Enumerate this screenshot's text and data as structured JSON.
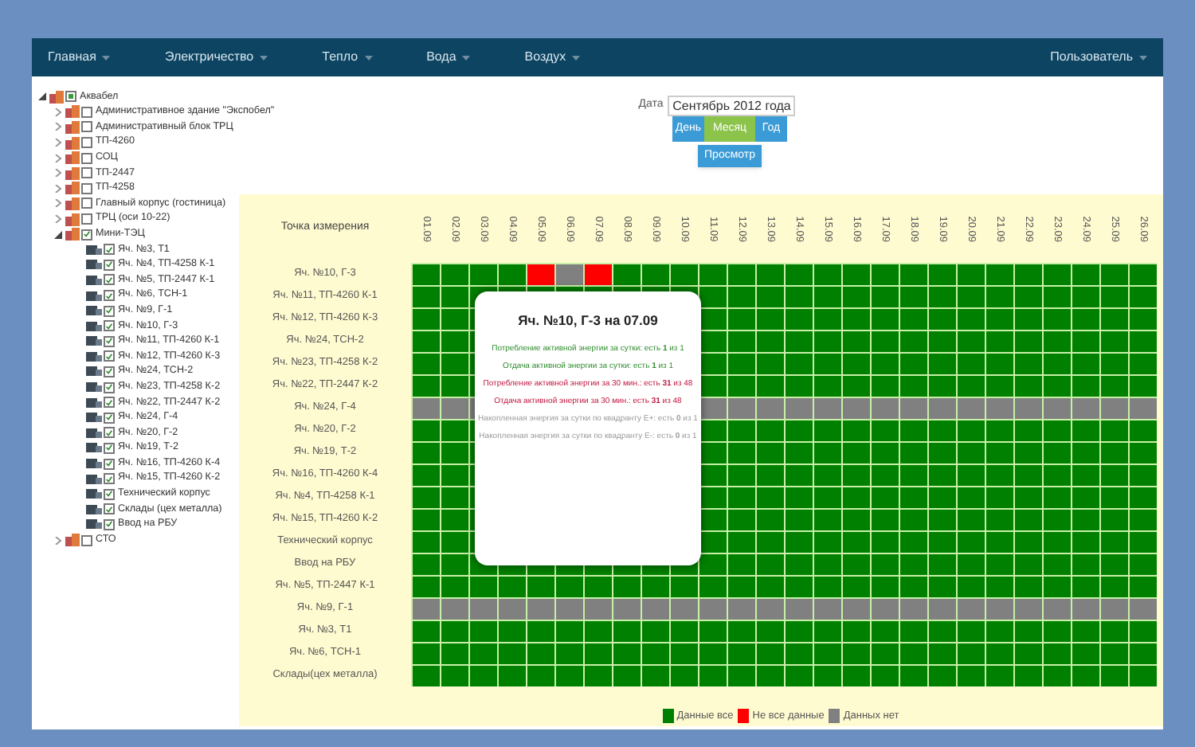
{
  "nav": {
    "items": [
      {
        "label": "Главная"
      },
      {
        "label": "Электричество"
      },
      {
        "label": "Тепло"
      },
      {
        "label": "Вода"
      },
      {
        "label": "Воздух"
      }
    ],
    "user": "Пользователь"
  },
  "tree": [
    {
      "label": "Аквабел",
      "checked": true,
      "indeterminate": true,
      "expanded": true,
      "children": [
        {
          "label": "Административное здание \"Экспобел\"",
          "checked": false,
          "expanded": false
        },
        {
          "label": "Административный блок ТРЦ",
          "checked": false,
          "expanded": false
        },
        {
          "label": "ТП-4260",
          "checked": false,
          "expanded": false
        },
        {
          "label": "СОЦ",
          "checked": false,
          "expanded": false
        },
        {
          "label": "ТП-2447",
          "checked": false,
          "expanded": false
        },
        {
          "label": "ТП-4258",
          "checked": false,
          "expanded": false
        },
        {
          "label": "Главный корпус (гостиница)",
          "checked": false,
          "expanded": false
        },
        {
          "label": "ТРЦ (оси 10-22)",
          "checked": false,
          "expanded": false
        },
        {
          "label": "Мини-ТЭЦ",
          "checked": true,
          "expanded": true,
          "children": [
            {
              "label": "Яч. №3, Т1",
              "checked": true
            },
            {
              "label": "Яч. №4, ТП-4258 К-1",
              "checked": true
            },
            {
              "label": "Яч. №5, ТП-2447 К-1",
              "checked": true
            },
            {
              "label": "Яч. №6, ТСН-1",
              "checked": true
            },
            {
              "label": "Яч. №9, Г-1",
              "checked": true
            },
            {
              "label": "Яч. №10, Г-3",
              "checked": true
            },
            {
              "label": "Яч. №11, ТП-4260 К-1",
              "checked": true
            },
            {
              "label": "Яч. №12, ТП-4260 К-3",
              "checked": true
            },
            {
              "label": "Яч. №24, ТСН-2",
              "checked": true
            },
            {
              "label": "Яч. №23, ТП-4258 К-2",
              "checked": true
            },
            {
              "label": "Яч. №22, ТП-2447 К-2",
              "checked": true
            },
            {
              "label": "Яч. №24, Г-4",
              "checked": true
            },
            {
              "label": "Яч. №20, Г-2",
              "checked": true
            },
            {
              "label": "Яч. №19, Т-2",
              "checked": true
            },
            {
              "label": "Яч. №16, ТП-4260 К-4",
              "checked": true
            },
            {
              "label": "Яч. №15, ТП-4260 К-2",
              "checked": true
            },
            {
              "label": "Технический корпус",
              "checked": true
            },
            {
              "label": "Склады (цех металла)",
              "checked": true
            },
            {
              "label": "Ввод на РБУ",
              "checked": true
            }
          ]
        },
        {
          "label": "СТО",
          "checked": false,
          "expanded": false
        }
      ]
    }
  ],
  "period": {
    "label": "Дата",
    "value": "Сентябрь 2012 года",
    "buttons": [
      {
        "label": "День",
        "selected": false
      },
      {
        "label": "Месяц",
        "selected": true
      },
      {
        "label": "Год",
        "selected": false
      }
    ],
    "view": "Просмотр"
  },
  "grid": {
    "corner": "Точка измерения",
    "days": [
      "01.09",
      "02.09",
      "03.09",
      "04.09",
      "05.09",
      "06.09",
      "07.09",
      "08.09",
      "09.09",
      "10.09",
      "11.09",
      "12.09",
      "13.09",
      "14.09",
      "15.09",
      "16.09",
      "17.09",
      "18.09",
      "19.09",
      "20.09",
      "21.09",
      "22.09",
      "23.09",
      "24.09",
      "25.09",
      "26.09"
    ],
    "rows": [
      {
        "name": "Яч. №10, Г-3",
        "cells": [
          {
            "kind": "all"
          },
          {
            "kind": "all"
          },
          {
            "kind": "all"
          },
          {
            "kind": "all"
          },
          {
            "kind": "partial"
          },
          {
            "kind": "none"
          },
          {
            "kind": "partial"
          },
          {
            "kind": "all"
          },
          {
            "kind": "all"
          },
          {
            "kind": "all"
          },
          {
            "kind": "all"
          },
          {
            "kind": "all"
          },
          {
            "kind": "all"
          },
          {
            "kind": "all"
          },
          {
            "kind": "all"
          },
          {
            "kind": "all"
          },
          {
            "kind": "all"
          },
          {
            "kind": "all"
          },
          {
            "kind": "all"
          },
          {
            "kind": "all"
          },
          {
            "kind": "all"
          },
          {
            "kind": "all"
          },
          {
            "kind": "all"
          },
          {
            "kind": "all"
          },
          {
            "kind": "all"
          },
          {
            "kind": "all"
          }
        ]
      },
      {
        "name": "Яч. №11, ТП-4260 К-1",
        "cells": [
          {
            "kind": "all"
          },
          {
            "kind": "all"
          },
          {
            "kind": "all"
          },
          {
            "kind": "all"
          },
          {
            "kind": "all"
          },
          {
            "kind": "all"
          },
          {
            "kind": "all"
          },
          {
            "kind": "all"
          },
          {
            "kind": "all"
          },
          {
            "kind": "all"
          },
          {
            "kind": "all"
          },
          {
            "kind": "all"
          },
          {
            "kind": "all"
          },
          {
            "kind": "all"
          },
          {
            "kind": "all"
          },
          {
            "kind": "all"
          },
          {
            "kind": "all"
          },
          {
            "kind": "all"
          },
          {
            "kind": "all"
          },
          {
            "kind": "all"
          },
          {
            "kind": "all"
          },
          {
            "kind": "all"
          },
          {
            "kind": "all"
          },
          {
            "kind": "all"
          },
          {
            "kind": "all"
          },
          {
            "kind": "all"
          }
        ]
      },
      {
        "name": "Яч. №12, ТП-4260 К-3",
        "cells": [
          {
            "kind": "all"
          },
          {
            "kind": "all"
          },
          {
            "kind": "all"
          },
          {
            "kind": "covered"
          },
          {
            "kind": "covered"
          },
          {
            "kind": "covered"
          },
          {
            "kind": "covered"
          },
          {
            "kind": "covered"
          },
          {
            "kind": "covered"
          },
          {
            "kind": "covered"
          },
          {
            "kind": "all"
          },
          {
            "kind": "all"
          },
          {
            "kind": "all"
          },
          {
            "kind": "all"
          },
          {
            "kind": "all"
          },
          {
            "kind": "all"
          },
          {
            "kind": "all"
          },
          {
            "kind": "all"
          },
          {
            "kind": "all"
          },
          {
            "kind": "all"
          },
          {
            "kind": "all"
          },
          {
            "kind": "all"
          },
          {
            "kind": "all"
          },
          {
            "kind": "all"
          },
          {
            "kind": "all"
          },
          {
            "kind": "all"
          }
        ]
      },
      {
        "name": "Яч. №24, ТСН-2",
        "cells": [
          {
            "kind": "all"
          },
          {
            "kind": "all"
          },
          {
            "kind": "all"
          },
          {
            "kind": "covered"
          },
          {
            "kind": "covered"
          },
          {
            "kind": "covered"
          },
          {
            "kind": "covered"
          },
          {
            "kind": "covered"
          },
          {
            "kind": "covered"
          },
          {
            "kind": "covered"
          },
          {
            "kind": "all"
          },
          {
            "kind": "all"
          },
          {
            "kind": "all"
          },
          {
            "kind": "all"
          },
          {
            "kind": "all"
          },
          {
            "kind": "all"
          },
          {
            "kind": "all"
          },
          {
            "kind": "all"
          },
          {
            "kind": "all"
          },
          {
            "kind": "all"
          },
          {
            "kind": "all"
          },
          {
            "kind": "all"
          },
          {
            "kind": "all"
          },
          {
            "kind": "all"
          },
          {
            "kind": "all"
          },
          {
            "kind": "all"
          }
        ]
      },
      {
        "name": "Яч. №23, ТП-4258 К-2",
        "cells": [
          {
            "kind": "all"
          },
          {
            "kind": "all"
          },
          {
            "kind": "all"
          },
          {
            "kind": "covered"
          },
          {
            "kind": "covered"
          },
          {
            "kind": "covered"
          },
          {
            "kind": "covered"
          },
          {
            "kind": "covered"
          },
          {
            "kind": "covered"
          },
          {
            "kind": "covered"
          },
          {
            "kind": "all"
          },
          {
            "kind": "all"
          },
          {
            "kind": "all"
          },
          {
            "kind": "all"
          },
          {
            "kind": "all"
          },
          {
            "kind": "all"
          },
          {
            "kind": "all"
          },
          {
            "kind": "all"
          },
          {
            "kind": "all"
          },
          {
            "kind": "all"
          },
          {
            "kind": "all"
          },
          {
            "kind": "all"
          },
          {
            "kind": "all"
          },
          {
            "kind": "all"
          },
          {
            "kind": "all"
          },
          {
            "kind": "all"
          }
        ]
      },
      {
        "name": "Яч. №22, ТП-2447 К-2",
        "cells": [
          {
            "kind": "all"
          },
          {
            "kind": "all"
          },
          {
            "kind": "all"
          },
          {
            "kind": "covered"
          },
          {
            "kind": "covered"
          },
          {
            "kind": "covered"
          },
          {
            "kind": "covered"
          },
          {
            "kind": "covered"
          },
          {
            "kind": "covered"
          },
          {
            "kind": "covered"
          },
          {
            "kind": "all"
          },
          {
            "kind": "all"
          },
          {
            "kind": "all"
          },
          {
            "kind": "all"
          },
          {
            "kind": "all"
          },
          {
            "kind": "all"
          },
          {
            "kind": "all"
          },
          {
            "kind": "all"
          },
          {
            "kind": "all"
          },
          {
            "kind": "all"
          },
          {
            "kind": "all"
          },
          {
            "kind": "all"
          },
          {
            "kind": "all"
          },
          {
            "kind": "all"
          },
          {
            "kind": "all"
          },
          {
            "kind": "all"
          }
        ]
      },
      {
        "name": "Яч. №24, Г-4",
        "cells": [
          {
            "kind": "none"
          },
          {
            "kind": "none"
          },
          {
            "kind": "none"
          },
          {
            "kind": "covered"
          },
          {
            "kind": "covered"
          },
          {
            "kind": "covered"
          },
          {
            "kind": "covered"
          },
          {
            "kind": "covered"
          },
          {
            "kind": "covered"
          },
          {
            "kind": "covered"
          },
          {
            "kind": "none"
          },
          {
            "kind": "none"
          },
          {
            "kind": "none"
          },
          {
            "kind": "none"
          },
          {
            "kind": "none"
          },
          {
            "kind": "none"
          },
          {
            "kind": "none"
          },
          {
            "kind": "none"
          },
          {
            "kind": "none"
          },
          {
            "kind": "none"
          },
          {
            "kind": "none"
          },
          {
            "kind": "none"
          },
          {
            "kind": "none"
          },
          {
            "kind": "none"
          },
          {
            "kind": "none"
          },
          {
            "kind": "none"
          }
        ]
      },
      {
        "name": "Яч. №20, Г-2",
        "cells": [
          {
            "kind": "all"
          },
          {
            "kind": "all"
          },
          {
            "kind": "all"
          },
          {
            "kind": "covered"
          },
          {
            "kind": "covered"
          },
          {
            "kind": "covered"
          },
          {
            "kind": "covered"
          },
          {
            "kind": "covered"
          },
          {
            "kind": "covered"
          },
          {
            "kind": "covered"
          },
          {
            "kind": "all"
          },
          {
            "kind": "all"
          },
          {
            "kind": "all"
          },
          {
            "kind": "all"
          },
          {
            "kind": "all"
          },
          {
            "kind": "all"
          },
          {
            "kind": "all"
          },
          {
            "kind": "all"
          },
          {
            "kind": "all"
          },
          {
            "kind": "all"
          },
          {
            "kind": "all"
          },
          {
            "kind": "all"
          },
          {
            "kind": "all"
          },
          {
            "kind": "all"
          },
          {
            "kind": "all"
          },
          {
            "kind": "all"
          }
        ]
      },
      {
        "name": "Яч. №19, Т-2",
        "cells": [
          {
            "kind": "all"
          },
          {
            "kind": "all"
          },
          {
            "kind": "all"
          },
          {
            "kind": "covered"
          },
          {
            "kind": "covered"
          },
          {
            "kind": "covered"
          },
          {
            "kind": "covered"
          },
          {
            "kind": "covered"
          },
          {
            "kind": "covered"
          },
          {
            "kind": "covered"
          },
          {
            "kind": "all"
          },
          {
            "kind": "all"
          },
          {
            "kind": "all"
          },
          {
            "kind": "all"
          },
          {
            "kind": "all"
          },
          {
            "kind": "all"
          },
          {
            "kind": "all"
          },
          {
            "kind": "all"
          },
          {
            "kind": "all"
          },
          {
            "kind": "all"
          },
          {
            "kind": "all"
          },
          {
            "kind": "all"
          },
          {
            "kind": "all"
          },
          {
            "kind": "all"
          },
          {
            "kind": "all"
          },
          {
            "kind": "all"
          }
        ]
      },
      {
        "name": "Яч. №16, ТП-4260 К-4",
        "cells": [
          {
            "kind": "all"
          },
          {
            "kind": "all"
          },
          {
            "kind": "all"
          },
          {
            "kind": "covered"
          },
          {
            "kind": "covered"
          },
          {
            "kind": "covered"
          },
          {
            "kind": "covered"
          },
          {
            "kind": "covered"
          },
          {
            "kind": "covered"
          },
          {
            "kind": "covered"
          },
          {
            "kind": "all"
          },
          {
            "kind": "all"
          },
          {
            "kind": "all"
          },
          {
            "kind": "all"
          },
          {
            "kind": "all"
          },
          {
            "kind": "all"
          },
          {
            "kind": "all"
          },
          {
            "kind": "all"
          },
          {
            "kind": "all"
          },
          {
            "kind": "all"
          },
          {
            "kind": "all"
          },
          {
            "kind": "all"
          },
          {
            "kind": "all"
          },
          {
            "kind": "all"
          },
          {
            "kind": "all"
          },
          {
            "kind": "all"
          }
        ]
      },
      {
        "name": "Яч. №4, ТП-4258 К-1",
        "cells": [
          {
            "kind": "all"
          },
          {
            "kind": "all"
          },
          {
            "kind": "all"
          },
          {
            "kind": "covered"
          },
          {
            "kind": "covered"
          },
          {
            "kind": "covered"
          },
          {
            "kind": "covered"
          },
          {
            "kind": "covered"
          },
          {
            "kind": "covered"
          },
          {
            "kind": "covered"
          },
          {
            "kind": "all"
          },
          {
            "kind": "all"
          },
          {
            "kind": "all"
          },
          {
            "kind": "all"
          },
          {
            "kind": "all"
          },
          {
            "kind": "all"
          },
          {
            "kind": "all"
          },
          {
            "kind": "all"
          },
          {
            "kind": "all"
          },
          {
            "kind": "all"
          },
          {
            "kind": "all"
          },
          {
            "kind": "all"
          },
          {
            "kind": "all"
          },
          {
            "kind": "all"
          },
          {
            "kind": "all"
          },
          {
            "kind": "all"
          }
        ]
      },
      {
        "name": "Яч. №15, ТП-4260 К-2",
        "cells": [
          {
            "kind": "all"
          },
          {
            "kind": "all"
          },
          {
            "kind": "all"
          },
          {
            "kind": "covered"
          },
          {
            "kind": "covered"
          },
          {
            "kind": "covered"
          },
          {
            "kind": "covered"
          },
          {
            "kind": "covered"
          },
          {
            "kind": "covered"
          },
          {
            "kind": "covered"
          },
          {
            "kind": "all"
          },
          {
            "kind": "all"
          },
          {
            "kind": "all"
          },
          {
            "kind": "all"
          },
          {
            "kind": "all"
          },
          {
            "kind": "all"
          },
          {
            "kind": "all"
          },
          {
            "kind": "all"
          },
          {
            "kind": "all"
          },
          {
            "kind": "all"
          },
          {
            "kind": "all"
          },
          {
            "kind": "all"
          },
          {
            "kind": "all"
          },
          {
            "kind": "all"
          },
          {
            "kind": "all"
          },
          {
            "kind": "all"
          }
        ]
      },
      {
        "name": "Технический корпус",
        "cells": [
          {
            "kind": "all"
          },
          {
            "kind": "all"
          },
          {
            "kind": "all"
          },
          {
            "kind": "covered"
          },
          {
            "kind": "covered"
          },
          {
            "kind": "covered"
          },
          {
            "kind": "covered"
          },
          {
            "kind": "covered"
          },
          {
            "kind": "covered"
          },
          {
            "kind": "covered"
          },
          {
            "kind": "all"
          },
          {
            "kind": "all"
          },
          {
            "kind": "all"
          },
          {
            "kind": "all"
          },
          {
            "kind": "all"
          },
          {
            "kind": "all"
          },
          {
            "kind": "all"
          },
          {
            "kind": "all"
          },
          {
            "kind": "all"
          },
          {
            "kind": "all"
          },
          {
            "kind": "all"
          },
          {
            "kind": "all"
          },
          {
            "kind": "all"
          },
          {
            "kind": "all"
          },
          {
            "kind": "all"
          },
          {
            "kind": "all"
          }
        ]
      },
      {
        "name": "Ввод на РБУ",
        "cells": [
          {
            "kind": "all"
          },
          {
            "kind": "all"
          },
          {
            "kind": "all"
          },
          {
            "kind": "all"
          },
          {
            "kind": "all"
          },
          {
            "kind": "all"
          },
          {
            "kind": "all"
          },
          {
            "kind": "all"
          },
          {
            "kind": "all"
          },
          {
            "kind": "all"
          },
          {
            "kind": "all"
          },
          {
            "kind": "all"
          },
          {
            "kind": "all"
          },
          {
            "kind": "all"
          },
          {
            "kind": "all"
          },
          {
            "kind": "all"
          },
          {
            "kind": "all"
          },
          {
            "kind": "all"
          },
          {
            "kind": "all"
          },
          {
            "kind": "all"
          },
          {
            "kind": "all"
          },
          {
            "kind": "all"
          },
          {
            "kind": "all"
          },
          {
            "kind": "all"
          },
          {
            "kind": "all"
          },
          {
            "kind": "all"
          }
        ]
      },
      {
        "name": "Яч. №5, ТП-2447 К-1",
        "cells": [
          {
            "kind": "all"
          },
          {
            "kind": "all"
          },
          {
            "kind": "all"
          },
          {
            "kind": "all"
          },
          {
            "kind": "all"
          },
          {
            "kind": "all"
          },
          {
            "kind": "all"
          },
          {
            "kind": "all"
          },
          {
            "kind": "all"
          },
          {
            "kind": "all"
          },
          {
            "kind": "all"
          },
          {
            "kind": "all"
          },
          {
            "kind": "all"
          },
          {
            "kind": "all"
          },
          {
            "kind": "all"
          },
          {
            "kind": "all"
          },
          {
            "kind": "all"
          },
          {
            "kind": "all"
          },
          {
            "kind": "all"
          },
          {
            "kind": "all"
          },
          {
            "kind": "all"
          },
          {
            "kind": "all"
          },
          {
            "kind": "all"
          },
          {
            "kind": "all"
          },
          {
            "kind": "all"
          },
          {
            "kind": "all"
          }
        ]
      },
      {
        "name": "Яч. №9, Г-1",
        "cells": [
          {
            "kind": "none"
          },
          {
            "kind": "none"
          },
          {
            "kind": "none"
          },
          {
            "kind": "none"
          },
          {
            "kind": "none"
          },
          {
            "kind": "none"
          },
          {
            "kind": "none"
          },
          {
            "kind": "none"
          },
          {
            "kind": "none"
          },
          {
            "kind": "none"
          },
          {
            "kind": "none"
          },
          {
            "kind": "none"
          },
          {
            "kind": "none"
          },
          {
            "kind": "none"
          },
          {
            "kind": "none"
          },
          {
            "kind": "none"
          },
          {
            "kind": "none"
          },
          {
            "kind": "none"
          },
          {
            "kind": "none"
          },
          {
            "kind": "none"
          },
          {
            "kind": "none"
          },
          {
            "kind": "none"
          },
          {
            "kind": "none"
          },
          {
            "kind": "none"
          },
          {
            "kind": "none"
          },
          {
            "kind": "none"
          }
        ]
      },
      {
        "name": "Яч. №3, Т1",
        "cells": [
          {
            "kind": "all"
          },
          {
            "kind": "all"
          },
          {
            "kind": "all"
          },
          {
            "kind": "all"
          },
          {
            "kind": "all"
          },
          {
            "kind": "all"
          },
          {
            "kind": "all"
          },
          {
            "kind": "all"
          },
          {
            "kind": "all"
          },
          {
            "kind": "all"
          },
          {
            "kind": "all"
          },
          {
            "kind": "all"
          },
          {
            "kind": "all"
          },
          {
            "kind": "all"
          },
          {
            "kind": "all"
          },
          {
            "kind": "all"
          },
          {
            "kind": "all"
          },
          {
            "kind": "all"
          },
          {
            "kind": "all"
          },
          {
            "kind": "all"
          },
          {
            "kind": "all"
          },
          {
            "kind": "all"
          },
          {
            "kind": "all"
          },
          {
            "kind": "all"
          },
          {
            "kind": "all"
          },
          {
            "kind": "all"
          }
        ]
      },
      {
        "name": "Яч. №6, ТСН-1",
        "cells": [
          {
            "kind": "all"
          },
          {
            "kind": "all"
          },
          {
            "kind": "all"
          },
          {
            "kind": "all"
          },
          {
            "kind": "all"
          },
          {
            "kind": "all"
          },
          {
            "kind": "all"
          },
          {
            "kind": "all"
          },
          {
            "kind": "all"
          },
          {
            "kind": "all"
          },
          {
            "kind": "all"
          },
          {
            "kind": "all"
          },
          {
            "kind": "all"
          },
          {
            "kind": "all"
          },
          {
            "kind": "all"
          },
          {
            "kind": "all"
          },
          {
            "kind": "all"
          },
          {
            "kind": "all"
          },
          {
            "kind": "all"
          },
          {
            "kind": "all"
          },
          {
            "kind": "all"
          },
          {
            "kind": "all"
          },
          {
            "kind": "all"
          },
          {
            "kind": "all"
          },
          {
            "kind": "all"
          },
          {
            "kind": "all"
          }
        ]
      },
      {
        "name": "Склады(цех металла)",
        "cells": [
          {
            "kind": "all"
          },
          {
            "kind": "all"
          },
          {
            "kind": "all"
          },
          {
            "kind": "all"
          },
          {
            "kind": "all"
          },
          {
            "kind": "all"
          },
          {
            "kind": "all"
          },
          {
            "kind": "all"
          },
          {
            "kind": "all"
          },
          {
            "kind": "all"
          },
          {
            "kind": "all"
          },
          {
            "kind": "all"
          },
          {
            "kind": "all"
          },
          {
            "kind": "all"
          },
          {
            "kind": "all"
          },
          {
            "kind": "all"
          },
          {
            "kind": "all"
          },
          {
            "kind": "all"
          },
          {
            "kind": "all"
          },
          {
            "kind": "all"
          },
          {
            "kind": "all"
          },
          {
            "kind": "all"
          },
          {
            "kind": "all"
          },
          {
            "kind": "all"
          },
          {
            "kind": "all"
          },
          {
            "kind": "all"
          }
        ]
      }
    ]
  },
  "popup": {
    "title": "Яч. №10, Г-3 на 07.09",
    "lines": [
      {
        "kind": "all",
        "text": "Потребление активной энергии за сутки: есть **1** из 1"
      },
      {
        "kind": "all",
        "text": "Отдача активной энергии за сутки: есть **1** из 1"
      },
      {
        "kind": "partial",
        "text": "Потребление активной энергии за 30 мин.: есть **31** из 48"
      },
      {
        "kind": "partial",
        "text": "Отдача активной энергии за 30 мин.: есть **31** из 48"
      },
      {
        "kind": "none",
        "text": "Накопленная энергия за сутки по квадранту Е+: есть **0** из 1"
      },
      {
        "kind": "none",
        "text": "Накопленная энергия за сутки по квадранту Е-: есть **0** из 1"
      }
    ]
  },
  "legend": [
    {
      "kind": "all",
      "label": "Данные все"
    },
    {
      "kind": "partial",
      "label": "Не все данные"
    },
    {
      "kind": "none",
      "label": "Данных нет"
    }
  ]
}
